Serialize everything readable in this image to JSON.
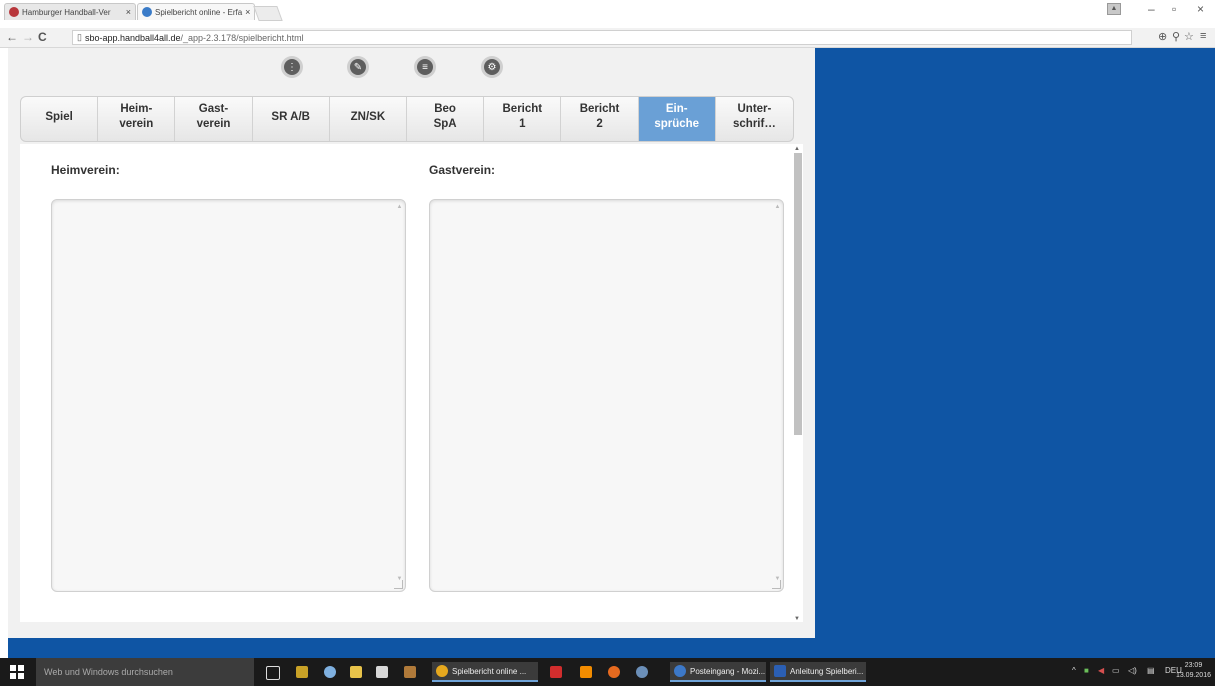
{
  "browser": {
    "tabs": [
      {
        "title": "Hamburger Handball-Ver",
        "close": "×"
      },
      {
        "title": "Spielbericht online - Erfa",
        "close": "×"
      }
    ],
    "url_host": "sbo-app.handball4all.de",
    "url_path": "/_app-2.3.178/spielbericht.html",
    "nav": {
      "back": "←",
      "forward": "→",
      "reload": "C"
    },
    "window": {
      "minimize": "–",
      "restore": "▫",
      "close": "×"
    }
  },
  "app": {
    "tabs": [
      {
        "label": "Spiel"
      },
      {
        "label": "Heim-\nverein"
      },
      {
        "label": "Gast-\nverein"
      },
      {
        "label": "SR A/B"
      },
      {
        "label": "ZN/SK"
      },
      {
        "label": "Beo\nSpA"
      },
      {
        "label": "Bericht\n1"
      },
      {
        "label": "Bericht\n2"
      },
      {
        "label": "Ein-\nsprüche"
      },
      {
        "label": "Unter-\nschrif…"
      }
    ],
    "active_tab": "Ein-\nsprüche",
    "heim_label": "Heimverein:",
    "gast_label": "Gastverein:",
    "heim_text": "",
    "gast_text": ""
  },
  "taskbar": {
    "search_placeholder": "Web und Windows durchsuchen",
    "apps": [
      {
        "label": "Spielbericht online ..."
      },
      {
        "label": "Posteingang - Mozi..."
      },
      {
        "label": "Anleitung Spielberi..."
      }
    ],
    "lang": "DEU",
    "time": "23:09",
    "date": "13.09.2016"
  },
  "colors": {
    "brand_blue": "#0f55a4",
    "active_tab": "#6aa0d6",
    "taskbar": "#1a1a1a"
  }
}
